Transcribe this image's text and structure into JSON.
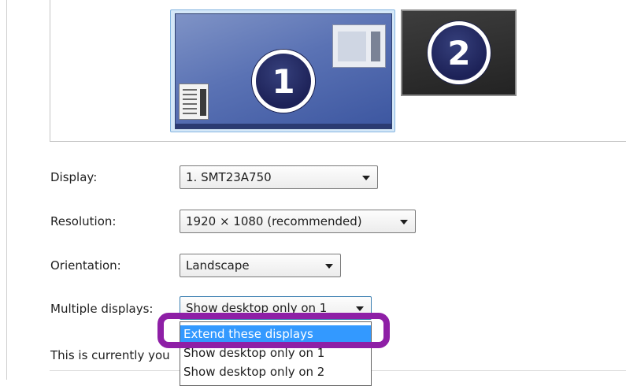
{
  "preview": {
    "monitor1_number": "1",
    "monitor2_number": "2"
  },
  "form": {
    "display_label": "Display:",
    "display_value": "1. SMT23A750",
    "resolution_label": "Resolution:",
    "resolution_value": "1920 × 1080 (recommended)",
    "orientation_label": "Orientation:",
    "orientation_value": "Landscape",
    "multiple_label": "Multiple displays:",
    "multiple_value": "Show desktop only on 1"
  },
  "multiple_options": [
    "Extend these displays",
    "Show desktop only on 1",
    "Show desktop only on 2"
  ],
  "multiple_selected_index": 0,
  "info_text": "This is currently you",
  "colors": {
    "highlight": "#8e1fa6",
    "selection": "#3399ff"
  }
}
